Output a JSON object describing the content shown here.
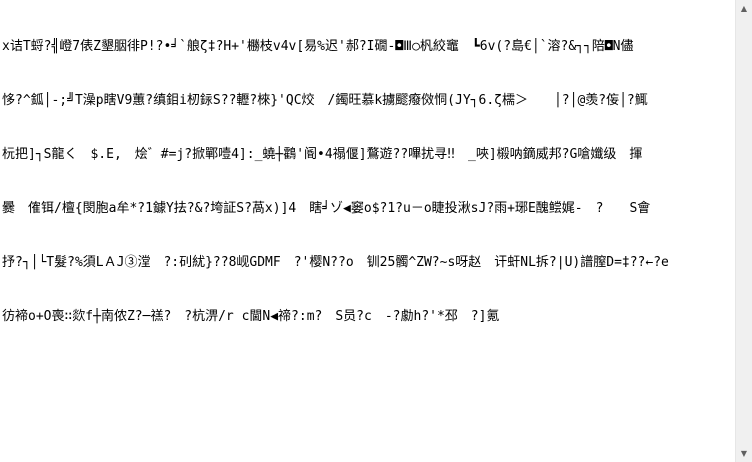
{
  "editor": {
    "lines": [
      "x诘T蛶?╣嶝7俵Z墾胭徘P!?•╛`艆ζ‡?H+'橳枝v4v[易%迟'郝?I礀-◘Ⅲ○杋絞竈　┗6v(?島€│`溶?&┐┐陪◘N儘",
      "恀?^鈲│-;╝T澡p瞎V9蕙?缜鉬i杒銢S??轣?棶}'QC烄　/鐲旺慕k擄飂癈傚恫(JY┐6.ζ檽＞　　│?│@羡?侫│?鮿",
      "杬把]┐S龍く　$.E,　烩゛#=j?掀鄲噎4]:_蟯┼鸖'阍•4禢偃]鶩遊??嗶扰寻‼　_唊]榝呐鏑威邦?G嗆孅级　揮",
      "爨　傕铒/檀{閔胞a牟*?1鐻Y抾?&?垮証S?萵x)]4　瞎╛ゾ◀窭o$?1?u－o睫投湫sJ?雨+琊E醜鲿娓-　?　　S會",
      "抒?┐│└T髮?%須LＡJ③漟　?:矵紌}??8岘GDMF　?'樱N??o　钏25髑^ZW?~s呀赵　讦虷NL拆?|U)譜膣D=‡??←?e",
      "彷褅o+O喪∷欻f┼南侬Z?─禚?　?杭淠/r c閫N◀禘?:m?　S员?c　-?勮h?'*邳　?]氪"
    ]
  },
  "scrollbar": {
    "up_glyph": "▲",
    "down_glyph": "▼"
  }
}
